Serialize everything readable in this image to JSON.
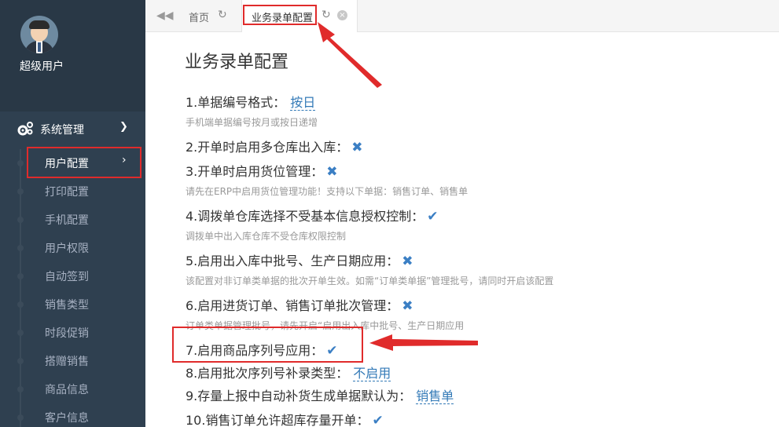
{
  "sidebar": {
    "username": "超级用户",
    "menu_header": "系统管理",
    "items": [
      {
        "label": "用户配置"
      },
      {
        "label": "打印配置"
      },
      {
        "label": "手机配置"
      },
      {
        "label": "用户权限"
      },
      {
        "label": "自动签到"
      },
      {
        "label": "销售类型"
      },
      {
        "label": "时段促销"
      },
      {
        "label": "搭赠销售"
      },
      {
        "label": "商品信息"
      },
      {
        "label": "客户信息"
      }
    ]
  },
  "tabs": {
    "home_label": "首页",
    "active_label": "业务录单配置"
  },
  "main": {
    "title": "业务录单配置",
    "settings": [
      {
        "label": "1.单据编号格式：",
        "value": "按日",
        "hint": "手机端单据编号按月或按日递增"
      },
      {
        "label": "2.开单时启用多仓库出入库："
      },
      {
        "label": "3.开单时启用货位管理：",
        "hint": "请先在ERP中启用货位管理功能！支持以下单据：销售订单、销售单"
      },
      {
        "label": "4.调拨单仓库选择不受基本信息授权控制：",
        "hint": "调拨单中出入库仓库不受仓库权限控制"
      },
      {
        "label": "5.启用出入库中批号、生产日期应用：",
        "hint": "该配置对非订单类单据的批次开单生效。如需“订单类单据”管理批号，请同时开启该配置"
      },
      {
        "label": "6.启用进货订单、销售订单批次管理：",
        "hint": "订单类单据管理批号，请先开启“启用出入库中批号、生产日期应用"
      },
      {
        "label": "7.启用商品序列号应用："
      },
      {
        "label": "8.启用批次序列号补录类型：",
        "value": "不启用"
      },
      {
        "label": "9.存量上报中自动补货生成单据默认为：",
        "value": "销售单"
      },
      {
        "label": "10.销售订单允许超库存量开单："
      }
    ]
  },
  "colors": {
    "sidebar_bg": "#2f4050",
    "accent": "#337ab7",
    "highlight": "#e02b2b"
  }
}
